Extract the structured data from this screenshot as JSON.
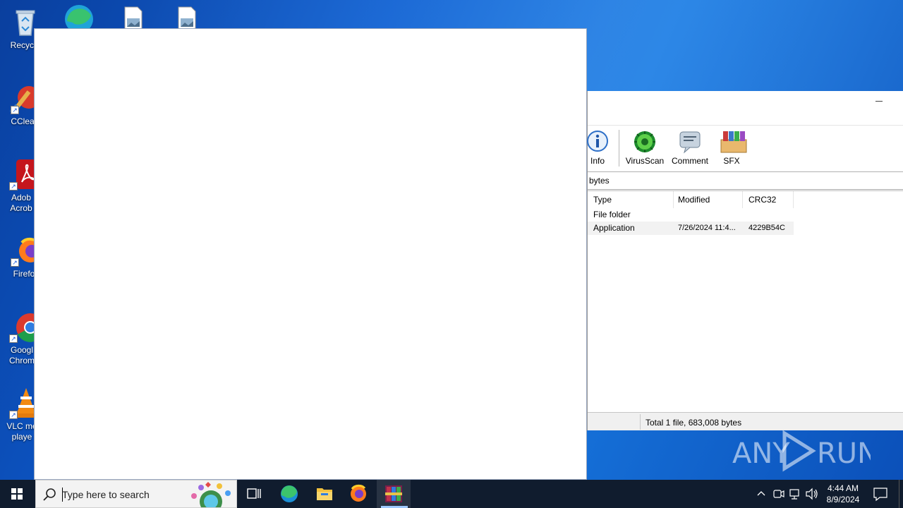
{
  "desktop": {
    "icons": [
      {
        "label": "Recycle"
      },
      {
        "label": "CClear"
      },
      {
        "label": "Adob Acrob"
      },
      {
        "label": "Firefo"
      },
      {
        "label": "Googl Chrom"
      },
      {
        "label": "VLC me playe"
      }
    ]
  },
  "archiver": {
    "toolbar": [
      {
        "label": "Info",
        "icon": "info-icon"
      },
      {
        "label": "VirusScan",
        "icon": "virus-scan-icon"
      },
      {
        "label": "Comment",
        "icon": "comment-icon"
      },
      {
        "label": "SFX",
        "icon": "sfx-icon"
      }
    ],
    "address_text": "bytes",
    "columns": [
      "Type",
      "Modified",
      "CRC32"
    ],
    "rows": [
      {
        "type": "File folder",
        "modified": "",
        "crc": ""
      },
      {
        "type": "Application",
        "modified": "7/26/2024 11:4...",
        "crc": "4229B54C"
      }
    ],
    "status": "Total 1 file, 683,008 bytes"
  },
  "watermark": {
    "text": "ANY RUN"
  },
  "taskbar": {
    "search_placeholder": "Type here to search",
    "apps": [
      "start-icon",
      "task-view-icon",
      "edge-icon",
      "file-explorer-icon",
      "firefox-icon",
      "winrar-icon"
    ],
    "clock": {
      "time": "4:44 AM",
      "date": "8/9/2024"
    }
  },
  "colors": {
    "taskbar": "#101c2e",
    "desktop_accent": "#0d5ccf"
  }
}
